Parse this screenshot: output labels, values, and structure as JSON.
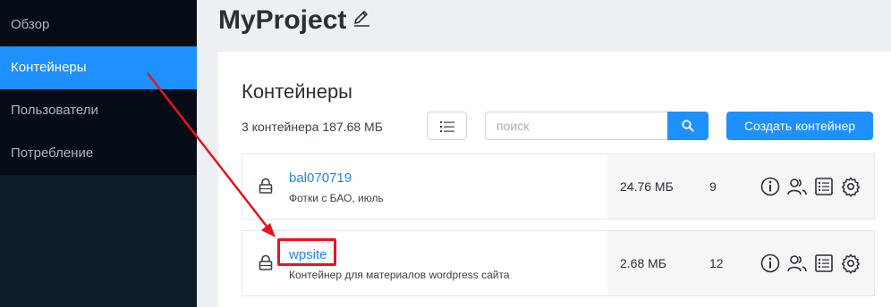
{
  "sidebar": {
    "items": [
      {
        "label": "Обзор",
        "active": false
      },
      {
        "label": "Контейнеры",
        "active": true
      },
      {
        "label": "Пользователи",
        "active": false
      },
      {
        "label": "Потребление",
        "active": false
      }
    ]
  },
  "header": {
    "project_name": "MyProject",
    "edit_icon": "pencil-icon"
  },
  "main": {
    "title": "Контейнеры",
    "summary": "3 контейнера 187.68 МБ",
    "search_placeholder": "поиск",
    "create_button": "Создать контейнер",
    "containers": [
      {
        "name": "bal070719",
        "description": "Фотки с БАО, июль",
        "size": "24.76 МБ",
        "count": "9",
        "locked": true
      },
      {
        "name": "wpsite",
        "description": "Контейнер для материалов wordpress сайта",
        "size": "2.68 МБ",
        "count": "12",
        "locked": true,
        "highlighted": true
      }
    ],
    "row_actions": [
      "info-icon",
      "users-icon",
      "list-icon",
      "gear-icon"
    ]
  },
  "colors": {
    "accent": "#1e90ff",
    "sidebar_bg": "#0d1b2b",
    "annotation": "#e8141c"
  }
}
